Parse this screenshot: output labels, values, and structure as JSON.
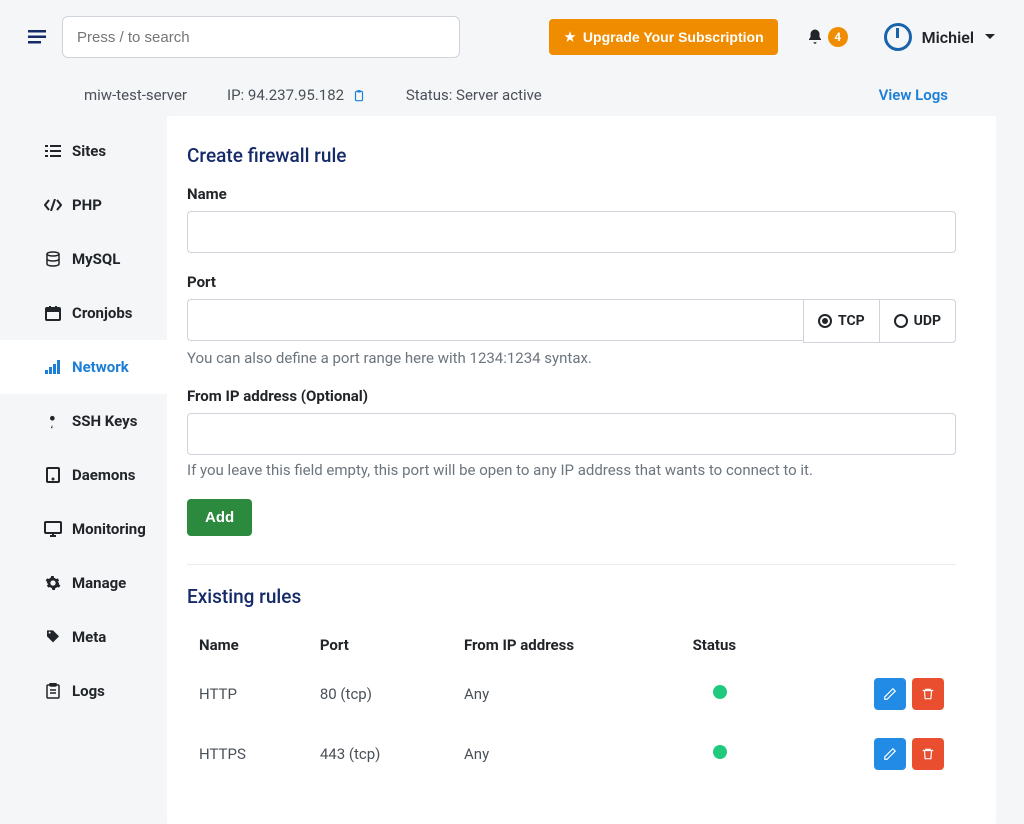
{
  "search": {
    "placeholder": "Press / to search"
  },
  "upgrade": {
    "label": "Upgrade Your Subscription"
  },
  "notifications": {
    "count": "4"
  },
  "user": {
    "name": "Michiel"
  },
  "server": {
    "name": "miw-test-server",
    "ip_label": "IP: 94.237.95.182",
    "status_label": "Status: Server active",
    "logs_link": "View Logs"
  },
  "sidebar": {
    "items": [
      {
        "label": "Sites"
      },
      {
        "label": "PHP"
      },
      {
        "label": "MySQL"
      },
      {
        "label": "Cronjobs"
      },
      {
        "label": "Network"
      },
      {
        "label": "SSH Keys"
      },
      {
        "label": "Daemons"
      },
      {
        "label": "Monitoring"
      },
      {
        "label": "Manage"
      },
      {
        "label": "Meta"
      },
      {
        "label": "Logs"
      }
    ]
  },
  "form": {
    "title": "Create firewall rule",
    "name_label": "Name",
    "port_label": "Port",
    "port_help": "You can also define a port range here with 1234:1234 syntax.",
    "tcp_label": "TCP",
    "udp_label": "UDP",
    "fromip_label": "From IP address (Optional)",
    "fromip_help": "If you leave this field empty, this port will be open to any IP address that wants to connect to it.",
    "add_label": "Add"
  },
  "existing": {
    "title": "Existing rules",
    "headers": {
      "name": "Name",
      "port": "Port",
      "from": "From IP address",
      "status": "Status"
    },
    "rows": [
      {
        "name": "HTTP",
        "port": "80 (tcp)",
        "from": "Any"
      },
      {
        "name": "HTTPS",
        "port": "443 (tcp)",
        "from": "Any"
      }
    ]
  }
}
